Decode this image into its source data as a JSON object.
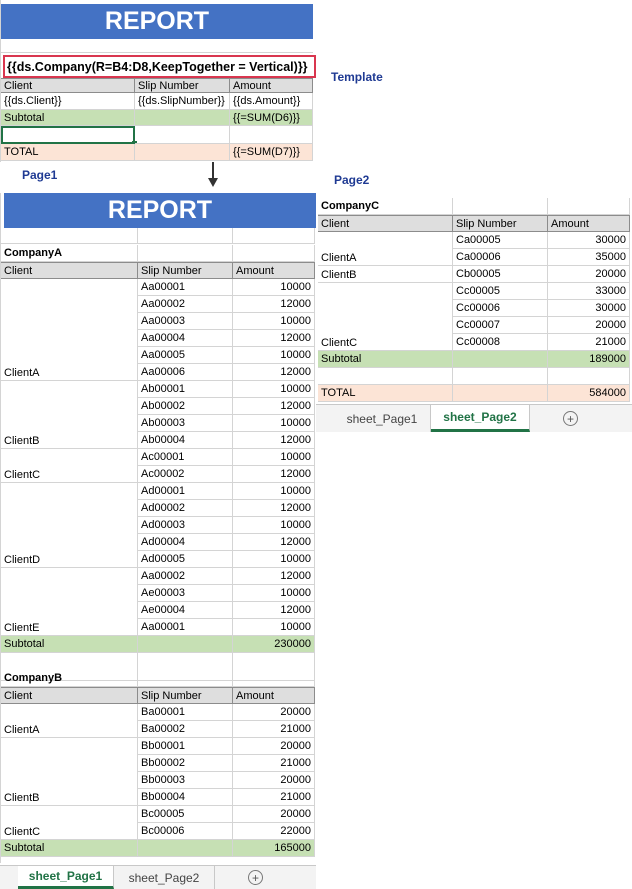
{
  "template": {
    "report_title": "REPORT",
    "range_formula": "{{ds.Company(R=B4:D8,KeepTogether = Vertical)}}",
    "label": "Template",
    "headers": [
      "Client",
      "Slip Number",
      "Amount"
    ],
    "detail_row": [
      "{{ds.Client}}",
      "{{ds.SlipNumber}}",
      "{{ds.Amount}}"
    ],
    "subtotal_row": [
      "Subtotal",
      "",
      "{{=SUM(D6)}}"
    ],
    "total_row": [
      "TOTAL",
      "",
      "{{=SUM(D7)}}"
    ]
  },
  "page1": {
    "label": "Page1",
    "report_title": "REPORT",
    "companyA": {
      "name": "CompanyA",
      "headers": [
        "Client",
        "Slip Number",
        "Amount"
      ],
      "groups": [
        {
          "client": "ClientA",
          "rows": [
            [
              "Aa00001",
              "10000"
            ],
            [
              "Aa00002",
              "12000"
            ],
            [
              "Aa00003",
              "10000"
            ],
            [
              "Aa00004",
              "12000"
            ],
            [
              "Aa00005",
              "10000"
            ],
            [
              "Aa00006",
              "12000"
            ]
          ]
        },
        {
          "client": "ClientB",
          "rows": [
            [
              "Ab00001",
              "10000"
            ],
            [
              "Ab00002",
              "12000"
            ],
            [
              "Ab00003",
              "10000"
            ],
            [
              "Ab00004",
              "12000"
            ]
          ]
        },
        {
          "client": "ClientC",
          "rows": [
            [
              "Ac00001",
              "10000"
            ],
            [
              "Ac00002",
              "12000"
            ]
          ]
        },
        {
          "client": "ClientD",
          "rows": [
            [
              "Ad00001",
              "10000"
            ],
            [
              "Ad00002",
              "12000"
            ],
            [
              "Ad00003",
              "10000"
            ],
            [
              "Ad00004",
              "12000"
            ],
            [
              "Ad00005",
              "10000"
            ]
          ]
        },
        {
          "client": "ClientE",
          "rows": [
            [
              "Aa00002",
              "12000"
            ],
            [
              "Ae00003",
              "10000"
            ],
            [
              "Ae00004",
              "12000"
            ],
            [
              "Aa00001",
              "10000"
            ]
          ]
        }
      ],
      "subtotal_label": "Subtotal",
      "subtotal": "230000"
    },
    "companyB": {
      "name": "CompanyB",
      "headers": [
        "Client",
        "Slip Number",
        "Amount"
      ],
      "groups": [
        {
          "client": "ClientA",
          "rows": [
            [
              "Ba00001",
              "20000"
            ],
            [
              "Ba00002",
              "21000"
            ]
          ]
        },
        {
          "client": "ClientB",
          "rows": [
            [
              "Bb00001",
              "20000"
            ],
            [
              "Bb00002",
              "21000"
            ],
            [
              "Bb00003",
              "20000"
            ],
            [
              "Bb00004",
              "21000"
            ]
          ]
        },
        {
          "client": "ClientC",
          "rows": [
            [
              "Bc00005",
              "20000"
            ],
            [
              "Bc00006",
              "22000"
            ]
          ]
        }
      ],
      "subtotal_label": "Subtotal",
      "subtotal": "165000"
    },
    "tabs": [
      "sheet_Page1",
      "sheet_Page2"
    ],
    "active_tab": 0
  },
  "page2": {
    "label": "Page2",
    "companyC": {
      "name": "CompanyC",
      "headers": [
        "Client",
        "Slip Number",
        "Amount"
      ],
      "groups": [
        {
          "client": "ClientA",
          "rows": [
            [
              "Ca00005",
              "30000"
            ],
            [
              "Ca00006",
              "35000"
            ]
          ]
        },
        {
          "client": "ClientB",
          "rows": [
            [
              "Cb00005",
              "20000"
            ]
          ]
        },
        {
          "client": "ClientC",
          "rows": [
            [
              "Cc00005",
              "33000"
            ],
            [
              "Cc00006",
              "30000"
            ],
            [
              "Cc00007",
              "20000"
            ],
            [
              "Cc00008",
              "21000"
            ]
          ]
        }
      ],
      "subtotal_label": "Subtotal",
      "subtotal": "189000"
    },
    "total_label": "TOTAL",
    "total": "584000",
    "tabs": [
      "sheet_Page1",
      "sheet_Page2"
    ],
    "active_tab": 1
  },
  "icons": {
    "arrow": "arrow-down-icon",
    "add_sheet": "plus-circle-icon"
  },
  "colors": {
    "banner": "#4472c4",
    "subtotal": "#c6e0b4",
    "total": "#fce4d6",
    "active_tab": "#217346",
    "formula_box": "#d9364f",
    "labels": "#1f3a93"
  }
}
